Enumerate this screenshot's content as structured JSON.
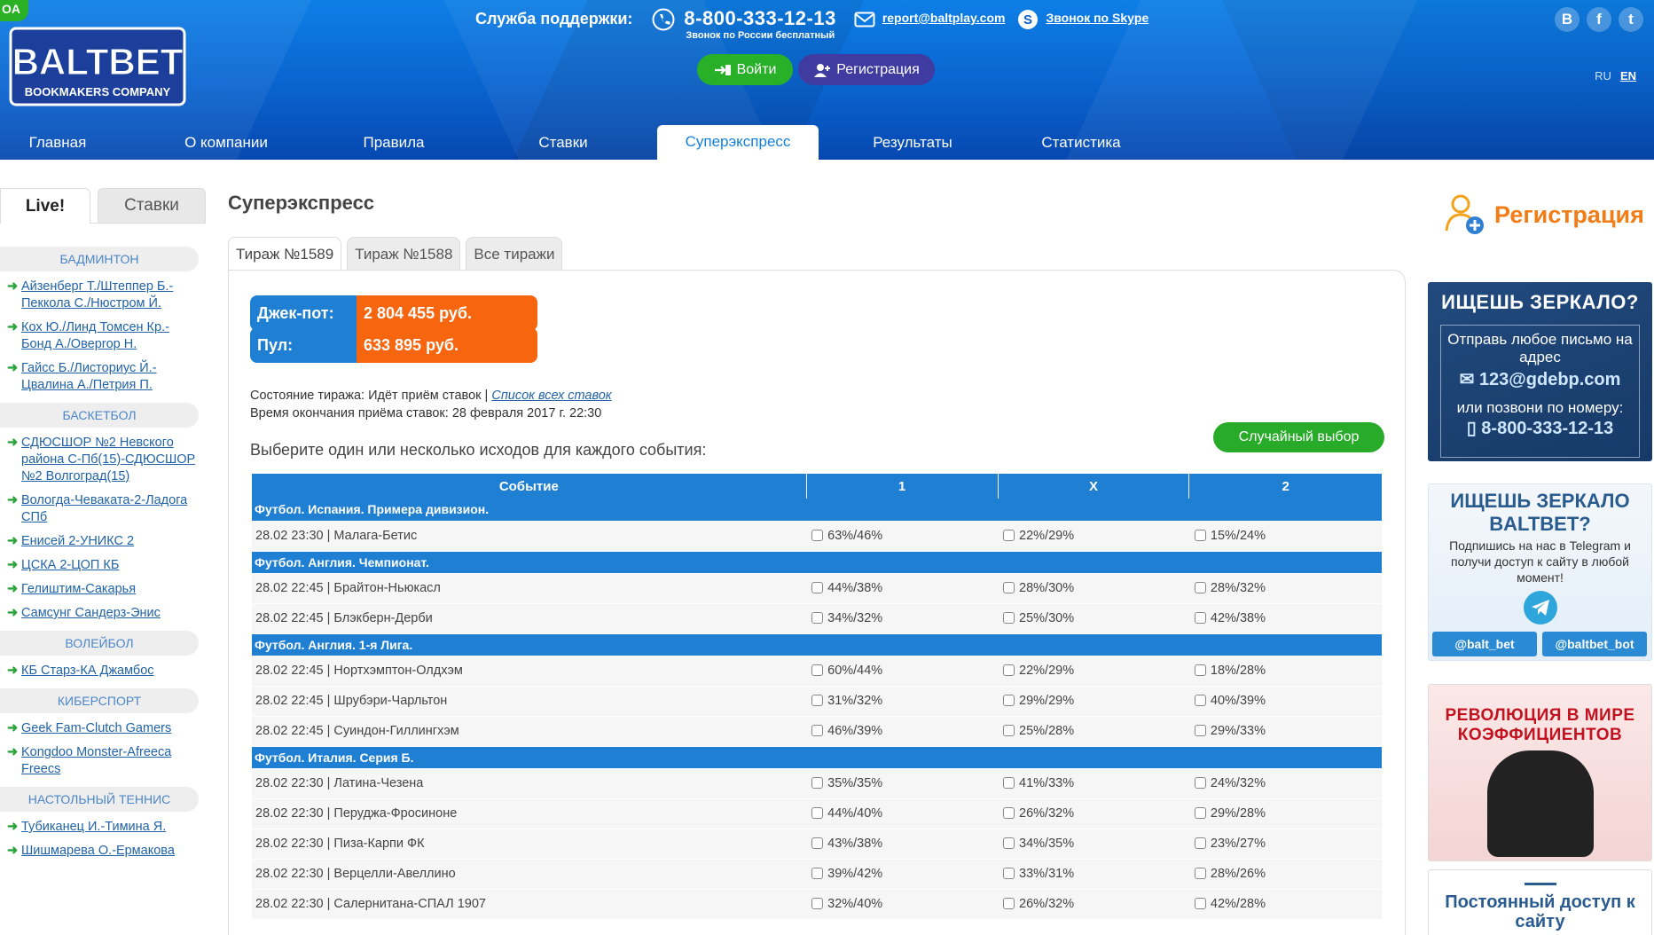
{
  "header": {
    "corner_badge": "OA",
    "logo": {
      "line1": "BALTBET",
      "line2": "BOOKMAKERS COMPANY"
    },
    "support_label": "Служба поддержки:",
    "phone": "8-800-333-12-13",
    "phone_note": "Звонок по России бесплатный",
    "email": "report@baltplay.com",
    "skype": "Звонок по Skype",
    "social": [
      "В",
      "f",
      "t"
    ],
    "lang": [
      "RU",
      "EN"
    ],
    "login_label": "Войти",
    "register_label": "Регистрация",
    "nav": [
      "Главная",
      "О компании",
      "Правила",
      "Ставки",
      "Суперэкспресс",
      "Результаты",
      "Статистика"
    ]
  },
  "sidebar": {
    "tab_live": "Live!",
    "tab_bets": "Ставки",
    "sports": [
      {
        "name": "БАДМИНТОН",
        "matches": [
          "Айзенберг Т./Штеппер Б.-Пеккола С./Нюстром Й.",
          "Кох Ю./Линд Томсен Кр.-Бонд А./Оверrop Н.",
          "Гайсс Б./Листориус Й.-Цвалина А./Петрия П."
        ]
      },
      {
        "name": "БАСКЕТБОЛ",
        "matches": [
          "СДЮСШОР №2 Невского района С-Пб(15)-СДЮСШОР №2 Волгоград(15)",
          "Вологда-Чеваката-2-Ладога СПб",
          "Енисей 2-УНИКС 2",
          "ЦСКА 2-ЦОП КБ",
          "Гелиштим-Сакарья",
          "Самсунг Сандерз-Энис"
        ]
      },
      {
        "name": "ВОЛЕЙБОЛ",
        "matches": [
          "КБ Старз-КА Джамбос"
        ]
      },
      {
        "name": "КИБЕРСПОРТ",
        "matches": [
          "Geek Fam-Clutch Gamers",
          "Kongdoo Monster-Afreeca Freecs"
        ]
      },
      {
        "name": "НАСТОЛЬНЫЙ ТЕННИС",
        "matches": [
          "Тубиканец И.-Тимина Я.",
          "Шишмарева О.-Ермакова"
        ]
      }
    ]
  },
  "main": {
    "title": "Суперэкспресс",
    "draw_tabs": [
      "Тираж №1589",
      "Тираж №1588",
      "Все тиражи"
    ],
    "jackpot_label": "Джек-пот:",
    "jackpot_value": "2 804 455 руб.",
    "pool_label": "Пул:",
    "pool_value": "633 895 руб.",
    "status_text": "Состояние тиража: Идёт приём ставок |",
    "status_link": "Список всех ставок",
    "deadline": "Время окончания приёма ставок: 28 февраля 2017 г. 22:30",
    "choose_text": "Выберите один или несколько исходов для каждого события:",
    "random_label": "Случайный выбор",
    "table": {
      "headers": [
        "Событие",
        "1",
        "X",
        "2"
      ],
      "groups": [
        {
          "title": "Футбол. Испания. Примера дивизион.",
          "events": [
            {
              "name": "28.02 23:30 | Малага-Бетис",
              "odds": [
                "63%/46%",
                "22%/29%",
                "15%/24%"
              ]
            }
          ]
        },
        {
          "title": "Футбол. Англия. Чемпионат.",
          "events": [
            {
              "name": "28.02 22:45 | Брайтон-Ньюкасл",
              "odds": [
                "44%/38%",
                "28%/30%",
                "28%/32%"
              ]
            },
            {
              "name": "28.02 22:45 | Блэкберн-Дерби",
              "odds": [
                "34%/32%",
                "25%/30%",
                "42%/38%"
              ]
            }
          ]
        },
        {
          "title": "Футбол. Англия. 1-я Лига.",
          "events": [
            {
              "name": "28.02 22:45 | Нортхэмптон-Олдхэм",
              "odds": [
                "60%/44%",
                "22%/29%",
                "18%/28%"
              ]
            },
            {
              "name": "28.02 22:45 | Шрубэри-Чарльтон",
              "odds": [
                "31%/32%",
                "29%/29%",
                "40%/39%"
              ]
            },
            {
              "name": "28.02 22:45 | Суиндон-Гиллингхэм",
              "odds": [
                "46%/39%",
                "25%/28%",
                "29%/33%"
              ]
            }
          ]
        },
        {
          "title": "Футбол. Италия. Серия Б.",
          "events": [
            {
              "name": "28.02 22:30 | Латина-Чезена",
              "odds": [
                "35%/35%",
                "41%/33%",
                "24%/32%"
              ]
            },
            {
              "name": "28.02 22:30 | Перуджа-Фросиноне",
              "odds": [
                "44%/40%",
                "26%/32%",
                "29%/28%"
              ]
            },
            {
              "name": "28.02 22:30 | Пиза-Карпи ФК",
              "odds": [
                "43%/38%",
                "34%/35%",
                "23%/27%"
              ]
            },
            {
              "name": "28.02 22:30 | Верцелли-Авеллино",
              "odds": [
                "39%/42%",
                "33%/31%",
                "28%/26%"
              ]
            },
            {
              "name": "28.02 22:30 | Салернитана-СПАЛ 1907",
              "odds": [
                "32%/40%",
                "26%/32%",
                "42%/28%"
              ]
            }
          ]
        }
      ]
    }
  },
  "right": {
    "register_label": "Регистрация",
    "mirror_banner": {
      "title": "ИЩЕШЬ ЗЕРКАЛО?",
      "line1": "Отправь любое письмо на адрес",
      "email": "123@gdebp.com",
      "line2": "или позвони по номеру:",
      "phone": "8-800-333-12-13"
    },
    "telegram_banner": {
      "title": "ИЩЕШЬ ЗЕРКАЛО BALTBET?",
      "subtitle": "Подпишись на нас в Telegram и получи доступ к сайту в любой момент!",
      "btn1": "@balt_bet",
      "btn2": "@baltbet_bot"
    },
    "revolution_banner": {
      "title": "РЕВОЛЮЦИЯ В МИРЕ КОЭФФИЦИЕНТОВ"
    },
    "access_banner": {
      "title": "Постоянный доступ к сайту"
    }
  },
  "colors": {
    "header_blue": "#0a63cf",
    "table_blue": "#1f7fd3",
    "green": "#29ab2a",
    "orange": "#f7650f",
    "purple": "#3f3ba0"
  }
}
